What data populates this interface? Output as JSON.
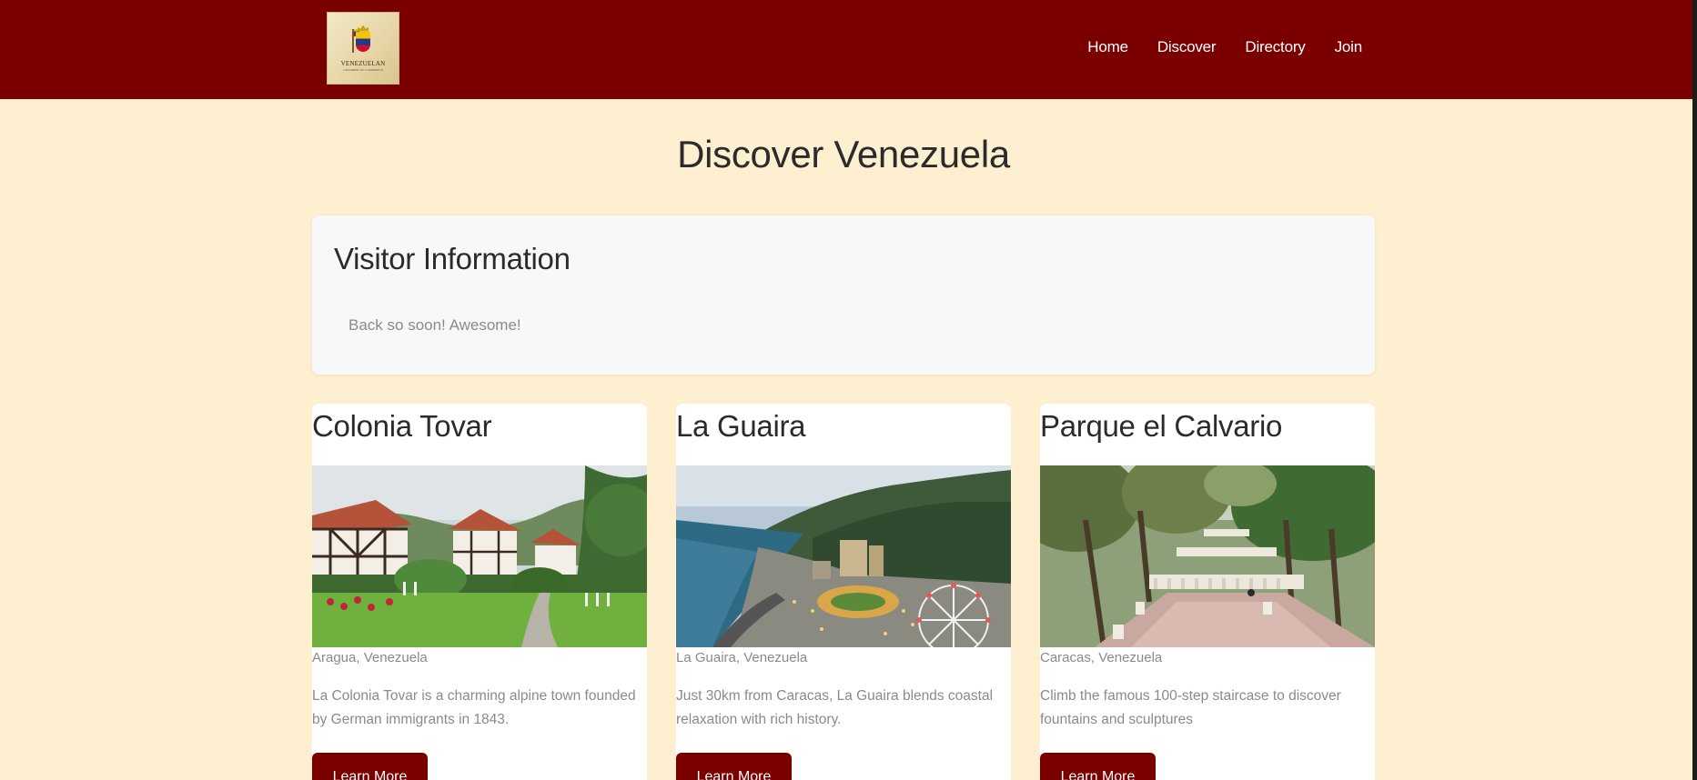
{
  "header": {
    "logo_text": "VENEZUELAN",
    "logo_subtext": "CHAMBER OF COMMERCE",
    "nav": [
      {
        "label": "Home"
      },
      {
        "label": "Discover"
      },
      {
        "label": "Directory"
      },
      {
        "label": "Join"
      }
    ]
  },
  "main": {
    "title": "Discover Venezuela",
    "visitor": {
      "heading": "Visitor Information",
      "message": "Back so soon! Awesome!"
    },
    "cards": [
      {
        "title": "Colonia Tovar",
        "location": "Aragua, Venezuela",
        "description": "La Colonia Tovar is a charming alpine town founded by German immigrants in 1843.",
        "button_label": "Learn More",
        "photo": "alpine-village-photo"
      },
      {
        "title": "La Guaira",
        "location": "La Guaira, Venezuela",
        "description": "Just 30km from Caracas, La Guaira blends coastal relaxation with rich history.",
        "button_label": "Learn More",
        "photo": "coastal-city-photo"
      },
      {
        "title": "Parque el Calvario",
        "location": "Caracas, Venezuela",
        "description": "Climb the famous 100-step staircase to discover fountains and sculptures",
        "button_label": "Learn More",
        "photo": "park-staircase-photo"
      }
    ]
  },
  "colors": {
    "brand": "#7a0000",
    "background": "#ffefd1",
    "panel": "#f7f8f9",
    "muted_text": "#8a8a8a"
  }
}
